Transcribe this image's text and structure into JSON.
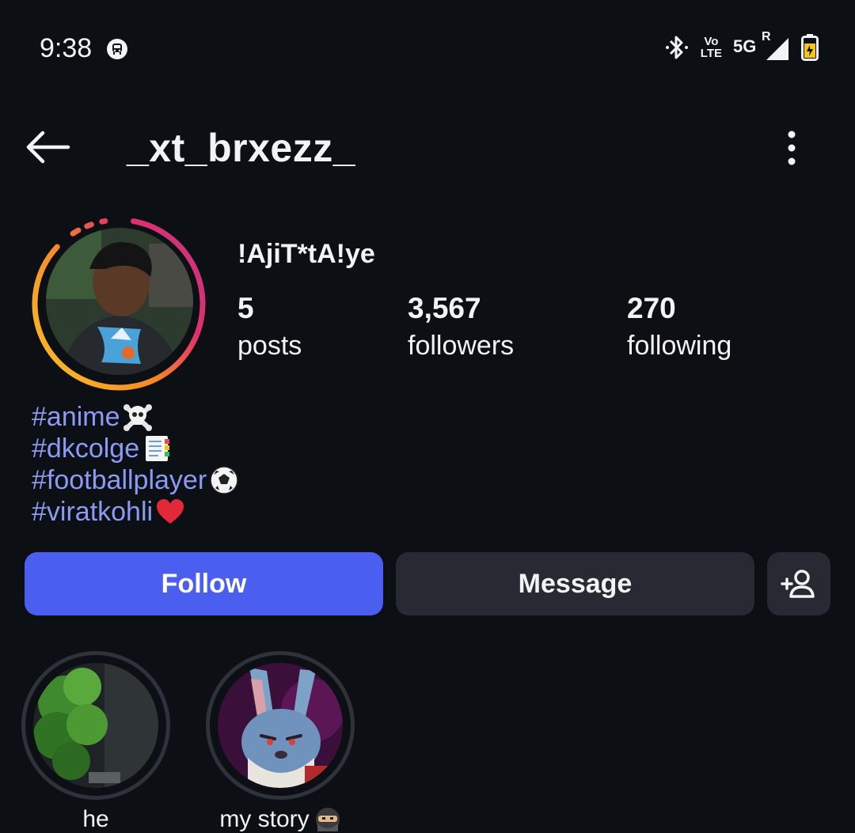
{
  "status_bar": {
    "time": "9:38",
    "network_label": "5G",
    "roaming_label": "R",
    "volte_top": "Vo",
    "volte_bottom": "LTE"
  },
  "header": {
    "username": "_xt_brxezz_"
  },
  "profile": {
    "display_name": "!AjiT*tA!ye",
    "stats": [
      {
        "value": "5",
        "label": "posts"
      },
      {
        "value": "3,567",
        "label": "followers"
      },
      {
        "value": "270",
        "label": "following"
      }
    ],
    "bio": [
      {
        "text": "#anime",
        "emoji": "skull-crossbones-icon"
      },
      {
        "text": "#dkcolge",
        "emoji": "notepad-icon"
      },
      {
        "text": "#footballplayer",
        "emoji": "soccer-ball-icon"
      },
      {
        "text": "#viratkohli",
        "emoji": "red-heart-icon"
      }
    ]
  },
  "actions": {
    "follow_label": "Follow",
    "message_label": "Message"
  },
  "highlights": [
    {
      "label": "he"
    },
    {
      "label": "my story",
      "emoji": "ninja-icon"
    }
  ],
  "colors": {
    "background": "#0c0f14",
    "accent": "#4a5ff0",
    "hashtag": "#8b9bf4",
    "secondary_button": "#272a32"
  }
}
